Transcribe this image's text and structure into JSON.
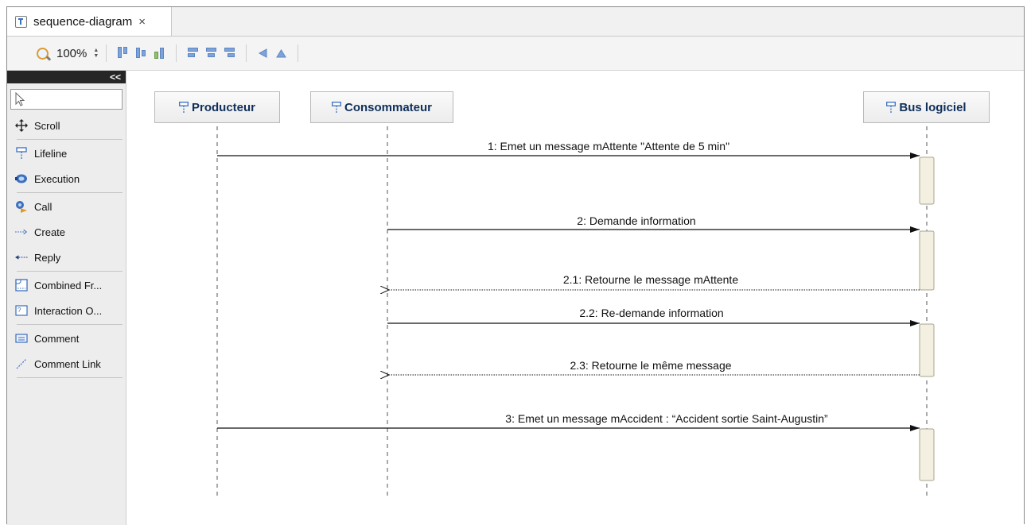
{
  "editor": {
    "tab_title": "sequence-diagram",
    "tab_close": "×"
  },
  "toolbar": {
    "zoom_value": "100%",
    "zoom_up": "▲",
    "zoom_down": "▼"
  },
  "palette": {
    "collapse_label": "<<",
    "items": [
      {
        "label": "Scroll",
        "icon": "scroll-icon"
      },
      {
        "label": "Lifeline",
        "icon": "lifeline-icon"
      },
      {
        "label": "Execution",
        "icon": "execution-icon"
      },
      {
        "label": "Call",
        "icon": "call-icon"
      },
      {
        "label": "Create",
        "icon": "create-icon"
      },
      {
        "label": "Reply",
        "icon": "reply-icon"
      },
      {
        "label": "Combined Fr...",
        "icon": "combined-fragment-icon"
      },
      {
        "label": "Interaction O...",
        "icon": "interaction-occurrence-icon"
      },
      {
        "label": "Comment",
        "icon": "comment-icon"
      },
      {
        "label": "Comment Link",
        "icon": "comment-link-icon"
      }
    ]
  },
  "diagram": {
    "lifelines": [
      {
        "name": "Producteur"
      },
      {
        "name": "Consommateur"
      },
      {
        "name": "Bus logiciel"
      }
    ],
    "messages": [
      {
        "label": "1: Emet un message mAttente \"Attente de 5 min\"",
        "from": "Producteur",
        "to": "Bus logiciel",
        "kind": "call"
      },
      {
        "label": "2: Demande information",
        "from": "Consommateur",
        "to": "Bus logiciel",
        "kind": "call"
      },
      {
        "label": "2.1: Retourne le message mAttente",
        "from": "Bus logiciel",
        "to": "Consommateur",
        "kind": "reply"
      },
      {
        "label": "2.2: Re-demande information",
        "from": "Consommateur",
        "to": "Bus logiciel",
        "kind": "call"
      },
      {
        "label": "2.3: Retourne le même message",
        "from": "Bus logiciel",
        "to": "Consommateur",
        "kind": "reply"
      },
      {
        "label": "3: Emet un message mAccident : “Accident sortie Saint-Augustin”",
        "from": "Producteur",
        "to": "Bus logiciel",
        "kind": "call"
      }
    ]
  },
  "colors": {
    "lifeline_text": "#0f2f5a",
    "execution_fill": "#f3f0e2",
    "execution_border": "#a9a48f",
    "accent_blue": "#3b6fbf"
  }
}
